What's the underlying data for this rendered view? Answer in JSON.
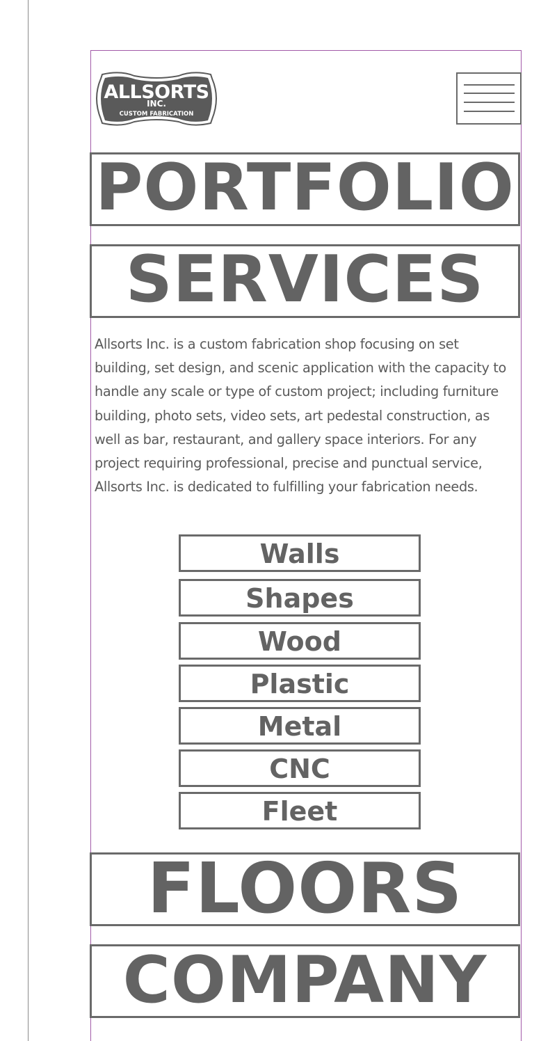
{
  "logo": {
    "line1": "ALLSORTS",
    "line2": "INC.",
    "line3": "CUSTOM FABRICATION"
  },
  "nav": {
    "portfolio": "PORTFOLIO",
    "services": "SERVICES",
    "floors": "FLOORS",
    "company": "COMPANY"
  },
  "intro": "Allsorts Inc. is a custom fabrication shop focusing on set building, set design, and scenic application with the capacity to handle any scale or type of custom project; including furniture building, photo sets, video sets, art pedestal construction, as well as bar, restaurant, and gallery space interiors.  For any project requiring professional, precise and punctual service, Allsorts Inc. is dedicated to fulfilling your fabrication needs.",
  "services": [
    "Walls",
    "Shapes",
    "Wood",
    "Plastic",
    "Metal",
    "CNC",
    "Fleet"
  ],
  "colors": {
    "text": "#636363",
    "border": "#6a6a6a",
    "frame": "#a25aa8",
    "logo_fill": "#5a5a5a"
  },
  "icons": {
    "menu": "hamburger-menu-icon"
  }
}
